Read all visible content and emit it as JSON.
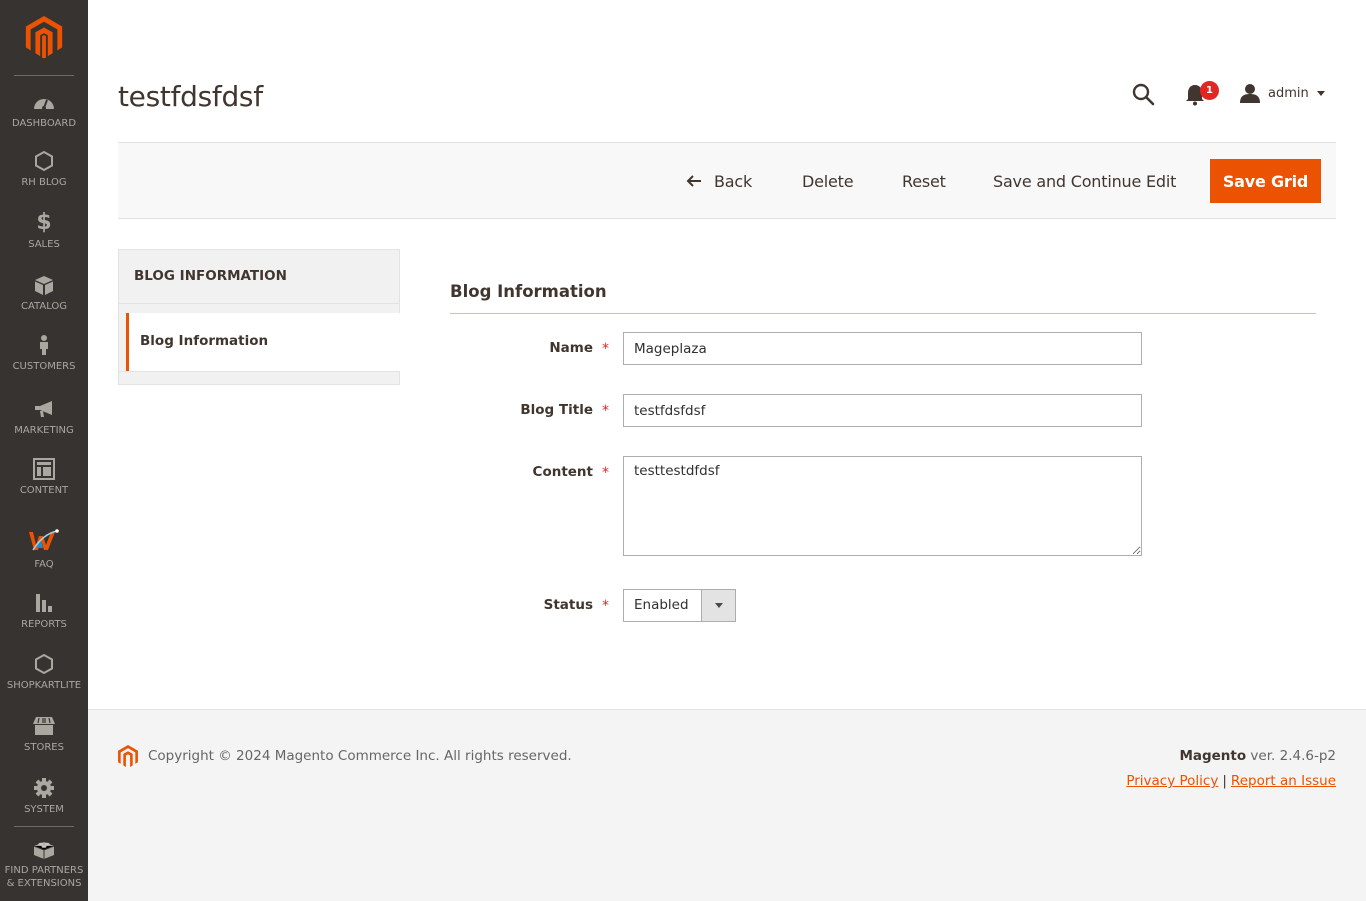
{
  "sidebar": {
    "items": [
      {
        "key": "dashboard",
        "label": "DASHBOARD",
        "icon": "speedometer-icon"
      },
      {
        "key": "rh-blog",
        "label": "RH BLOG",
        "icon": "hexagon-icon"
      },
      {
        "key": "sales",
        "label": "SALES",
        "icon": "dollar-icon"
      },
      {
        "key": "catalog",
        "label": "CATALOG",
        "icon": "box-icon"
      },
      {
        "key": "customers",
        "label": "CUSTOMERS",
        "icon": "person-icon"
      },
      {
        "key": "marketing",
        "label": "MARKETING",
        "icon": "megaphone-icon"
      },
      {
        "key": "content",
        "label": "CONTENT",
        "icon": "layout-icon"
      },
      {
        "key": "faq",
        "label": "FAQ",
        "icon": "faq-logo-icon"
      },
      {
        "key": "reports",
        "label": "REPORTS",
        "icon": "bar-chart-icon"
      },
      {
        "key": "shopkartlite",
        "label": "SHOPKARTLITE",
        "icon": "hexagon-icon"
      },
      {
        "key": "stores",
        "label": "STORES",
        "icon": "storefront-icon"
      },
      {
        "key": "system",
        "label": "SYSTEM",
        "icon": "gear-icon"
      },
      {
        "key": "partners",
        "label": "FIND PARTNERS",
        "label2": "& EXTENSIONS",
        "icon": "lego-brick-icon"
      }
    ]
  },
  "header": {
    "title": "testfdsfdsf",
    "notifications_count": "1",
    "user_name": "admin"
  },
  "actions": {
    "back": "Back",
    "delete": "Delete",
    "reset": "Reset",
    "save_continue": "Save and Continue Edit",
    "save": "Save Grid"
  },
  "tabs": {
    "title": "BLOG INFORMATION",
    "items": [
      {
        "label": "Blog Information",
        "active": true
      }
    ]
  },
  "form": {
    "section_title": "Blog Information",
    "fields": {
      "name": {
        "label": "Name",
        "value": "Mageplaza",
        "required": "*"
      },
      "blog_title": {
        "label": "Blog Title",
        "value": "testfdsfdsf",
        "required": "*"
      },
      "content": {
        "label": "Content",
        "value": "testtestdfdsf",
        "required": "*"
      },
      "status": {
        "label": "Status",
        "value": "Enabled",
        "required": "*"
      }
    }
  },
  "footer": {
    "copyright": "Copyright © 2024 Magento Commerce Inc. All rights reserved.",
    "brand": "Magento",
    "version": " ver. 2.4.6-p2",
    "privacy": "Privacy Policy",
    "separator": "|",
    "report": "Report an Issue"
  },
  "colors": {
    "accent": "#eb5202",
    "sidebar_bg": "#373330",
    "badge": "#e22626"
  }
}
